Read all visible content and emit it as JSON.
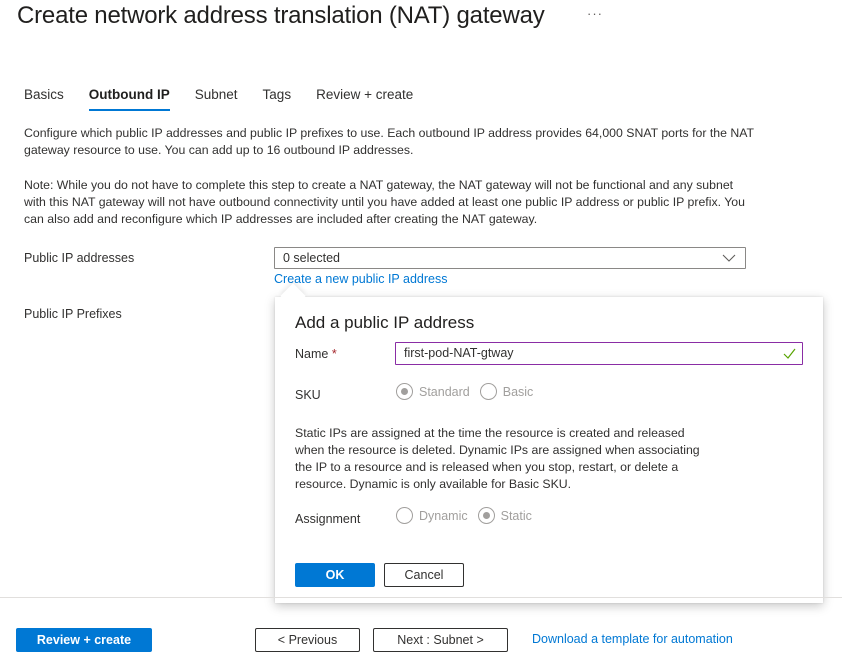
{
  "header": {
    "title": "Create network address translation (NAT) gateway",
    "more_label": "···"
  },
  "tabs": [
    {
      "label": "Basics",
      "active": false
    },
    {
      "label": "Outbound IP",
      "active": true
    },
    {
      "label": "Subnet",
      "active": false
    },
    {
      "label": "Tags",
      "active": false
    },
    {
      "label": "Review + create",
      "active": false
    }
  ],
  "content": {
    "description": "Configure which public IP addresses and public IP prefixes to use. Each outbound IP address provides 64,000 SNAT ports for the NAT gateway resource to use. You can add up to 16 outbound IP addresses.",
    "note": "Note: While you do not have to complete this step to create a NAT gateway, the NAT gateway will not be functional and any subnet with this NAT gateway will not have outbound connectivity until you have added at least one public IP address or public IP prefix. You can also add and reconfigure which IP addresses are included after creating the NAT gateway.",
    "public_ip_label": "Public IP addresses",
    "public_ip_value": "0 selected",
    "create_ip_link": "Create a new public IP address",
    "public_prefix_label": "Public IP Prefixes"
  },
  "panel": {
    "title": "Add a public IP address",
    "name_label": "Name",
    "required_mark": "*",
    "name_value": "first-pod-NAT-gtway",
    "sku_label": "SKU",
    "sku_options": [
      {
        "label": "Standard",
        "checked": true
      },
      {
        "label": "Basic",
        "checked": false
      }
    ],
    "info": "Static IPs are assigned at the time the resource is created and released when the resource is deleted. Dynamic IPs are assigned when associating the IP to a resource and is released when you stop, restart, or delete a resource. Dynamic is only available for Basic SKU.",
    "assignment_label": "Assignment",
    "assignment_options": [
      {
        "label": "Dynamic",
        "checked": false
      },
      {
        "label": "Static",
        "checked": true
      }
    ],
    "ok_label": "OK",
    "cancel_label": "Cancel"
  },
  "footer": {
    "review_create_label": "Review + create",
    "previous_label": "< Previous",
    "next_label": "Next : Subnet >",
    "download_link": "Download a template for automation"
  },
  "colors": {
    "accent": "#0078d4",
    "input_focus_border": "#8a2da5",
    "valid_check": "#57a300",
    "required": "#a4262c"
  }
}
